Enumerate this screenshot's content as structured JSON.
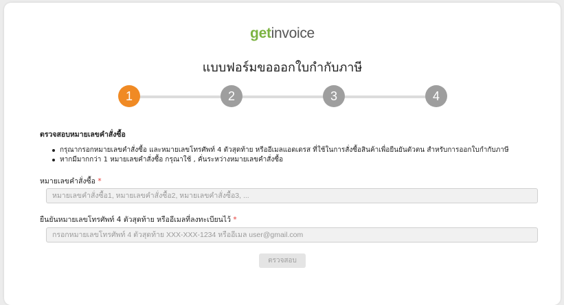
{
  "brand": {
    "part1": "get",
    "part2": "invoice"
  },
  "form": {
    "title": "แบบฟอร์มขอออกใบกำกับภาษี"
  },
  "steps": [
    "1",
    "2",
    "3",
    "4"
  ],
  "section": {
    "title": "ตรวจสอบหมายเลขคำสั่งซื้อ",
    "bullets": [
      "กรุณากรอกหมายเลขคำสั่งซื้อ และหมายเลขโทรศัพท์ 4 ตัวสุดท้าย หรืออีเมลแอดเดรส ที่ใช้ในการสั่งซื้อสินค้าเพื่อยืนยันตัวตน สำหรับการออกใบกำกับภาษี",
      "หากมีมากกว่า 1 หมายเลขคำสั่งซื้อ กรุณาใช้ , คั่นระหว่างหมายเลขคำสั่งซื้อ"
    ]
  },
  "fields": {
    "order": {
      "label": "หมายเลขคำสั่งซื้อ",
      "required_mark": "*",
      "value": "",
      "placeholder": "หมายเลขคำสั่งซื้อ1, หมายเลขคำสั่งซื้อ2, หมายเลขคำสั่งซื้อ3, ..."
    },
    "contact": {
      "label": "ยืนยันหมายเลขโทรศัพท์ 4 ตัวสุดท้าย หรืออีเมลที่ลงทะเบียนไว้",
      "required_mark": "*",
      "value": "",
      "placeholder": "กรอกหมายเลขโทรศัพท์ 4 ตัวสุดท้าย XXX-XXX-1234 หรืออีเมล user@gmail.com"
    }
  },
  "actions": {
    "verify_label": "ตรวจสอบ"
  },
  "colors": {
    "brand_green": "#7cb342",
    "step_active": "#f08a24",
    "step_inactive": "#9e9e9e",
    "required": "#e53935"
  }
}
